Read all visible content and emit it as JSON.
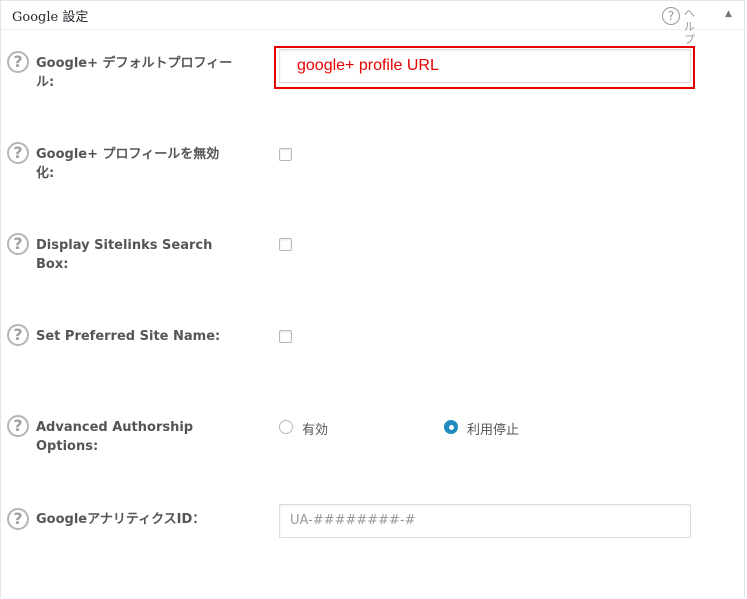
{
  "panel": {
    "title": "Google 設定",
    "help_label": "ヘルプ",
    "collapse_arrow": "▲"
  },
  "highlight": {
    "text": "google+  profile URL",
    "color": "#e60000"
  },
  "fields": {
    "default_profile": {
      "label": "Google+ デフォルトプロフィール:",
      "value": ""
    },
    "disable_profile": {
      "label": "Google+ プロフィールを無効化:",
      "checked": false
    },
    "sitelinks_search": {
      "label": "Display Sitelinks Search Box:",
      "checked": false
    },
    "preferred_site_name": {
      "label": "Set Preferred Site Name:",
      "checked": false
    },
    "advanced_authorship": {
      "label": "Advanced Authorship Options:",
      "options": [
        "有効",
        "利用停止"
      ],
      "selected": "利用停止"
    },
    "analytics_id": {
      "label": "GoogleアナリティクスID：",
      "placeholder": "UA-########-#"
    }
  },
  "help_icon_glyph": "?",
  "colors": {
    "accent": "#1e8cbe",
    "annotation": "#e60000"
  }
}
